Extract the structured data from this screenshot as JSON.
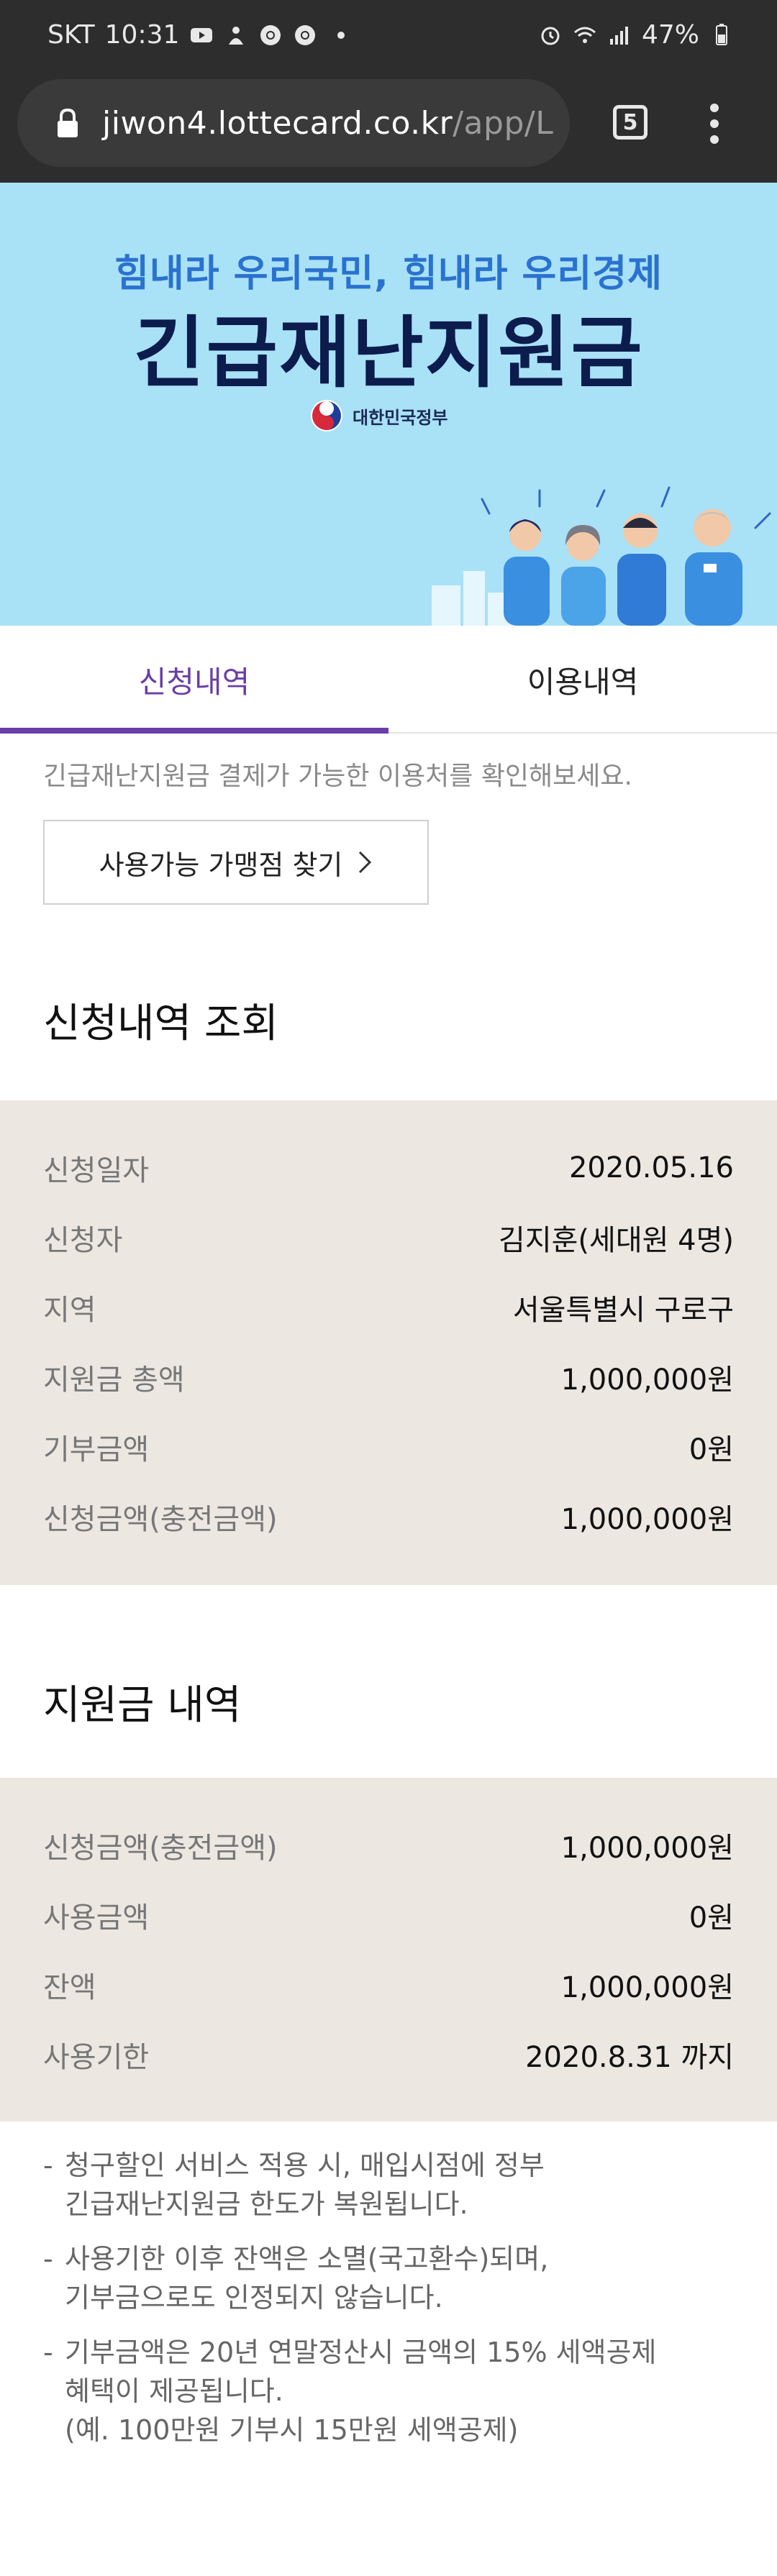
{
  "status_bar": {
    "carrier": "SKT",
    "time": "10:31",
    "battery": "47%",
    "icons_left": [
      "youtube-icon",
      "notification-icon",
      "chrome-icon",
      "chrome-icon"
    ],
    "icons_right": [
      "alarm-icon",
      "wifi-icon",
      "signal-icon",
      "battery-icon"
    ]
  },
  "browser": {
    "url_main": "jiwon4.lottecard.co.kr",
    "url_path": "/app/L",
    "tab_count": "5"
  },
  "banner": {
    "subtitle": "힘내라 우리국민, 힘내라 우리경제",
    "title": "긴급재난지원금",
    "gov_label": "대한민국정부",
    "bg_color": "#a9e1f7"
  },
  "tabs": [
    {
      "label": "신청내역",
      "active": true
    },
    {
      "label": "이용내역",
      "active": false
    }
  ],
  "info_text": "긴급재난지원금 결제가 가능한 이용처를 확인해보세요.",
  "find_button": "사용가능 가맹점 찾기",
  "application": {
    "title": "신청내역 조회",
    "rows": [
      {
        "label": "신청일자",
        "value": "2020.05.16"
      },
      {
        "label": "신청자",
        "value": "김지훈(세대원 4명)"
      },
      {
        "label": "지역",
        "value": "서울특별시 구로구"
      },
      {
        "label": "지원금 총액",
        "value": "1,000,000원"
      },
      {
        "label": "기부금액",
        "value": "0원"
      },
      {
        "label": "신청금액(충전금액)",
        "value": "1,000,000원"
      }
    ]
  },
  "support": {
    "title": "지원금 내역",
    "rows": [
      {
        "label": "신청금액(충전금액)",
        "value": "1,000,000원"
      },
      {
        "label": "사용금액",
        "value": "0원"
      },
      {
        "label": "잔액",
        "value": "1,000,000원"
      },
      {
        "label": "사용기한",
        "value": "2020.8.31 까지"
      }
    ]
  },
  "notes": [
    {
      "dash": "-",
      "text": "청구할인 서비스 적용 시, 매입시점에 정부\n긴급재난지원금 한도가 복원됩니다."
    },
    {
      "dash": "-",
      "text": "사용기한 이후 잔액은 소멸(국고환수)되며,\n기부금으로도 인정되지 않습니다."
    },
    {
      "dash": "-",
      "text": "기부금액은 20년 연말정산시 금액의 15% 세액공제\n혜택이 제공됩니다.\n(예. 100만원 기부시 15만원 세액공제)"
    }
  ],
  "colors": {
    "accent": "#6a3ea8",
    "panel_bg": "#ece7e1",
    "banner_title": "#0b1c4d",
    "banner_subtitle": "#2a72cf"
  }
}
